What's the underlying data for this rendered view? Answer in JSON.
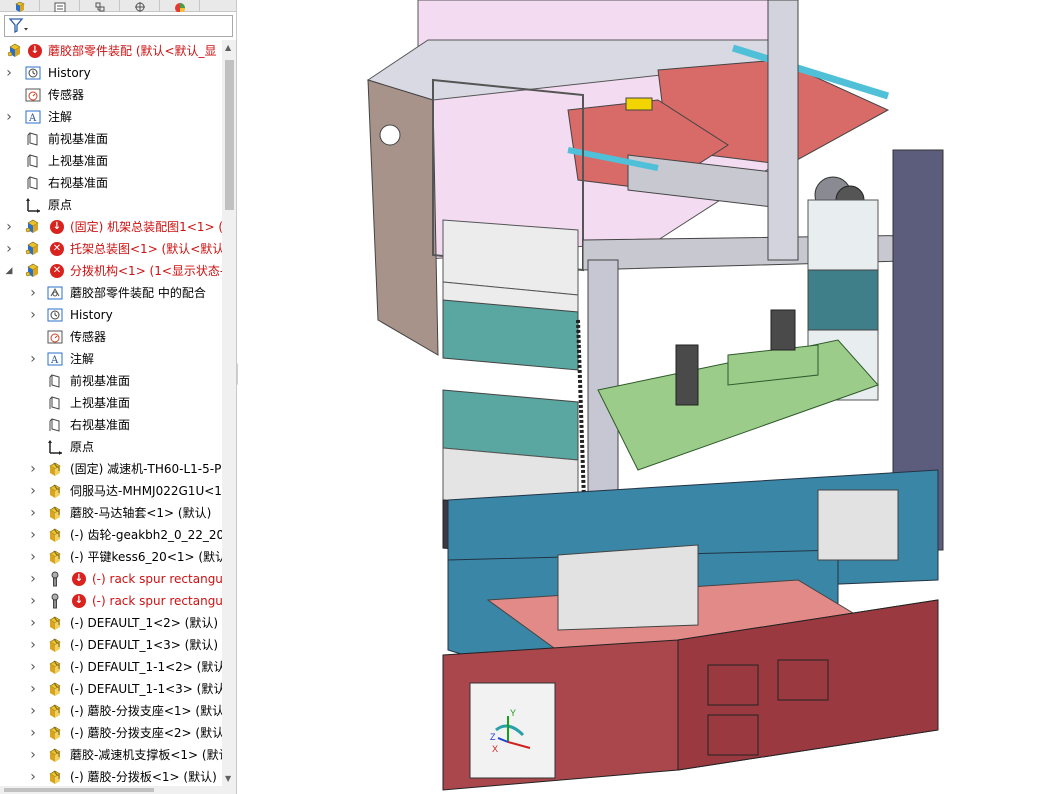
{
  "colors": {
    "error_red": "#cc1111",
    "warn_red": "#d8231f",
    "assembly_yellow": "#e8c22a",
    "assembly_blue": "#2a6fc9",
    "frame_gray": "#c8c8d0",
    "plate_teal": "#3a86a6",
    "base_red": "#a9474c",
    "green_part": "#9ccc8a"
  },
  "panel": {
    "tabs": [
      "feature-manager-icon",
      "property-manager-icon",
      "configuration-manager-icon",
      "dimxpert-icon",
      "display-manager-icon"
    ],
    "filter_icon": "filter-icon"
  },
  "tree": [
    {
      "level": 0,
      "expander": "",
      "icon": "assembly-icon",
      "status": "down",
      "label": "蘑胶部零件装配  (默认<默认_显",
      "error": true
    },
    {
      "level": 1,
      "expander": "right",
      "icon": "history-icon",
      "status": "",
      "label": "History",
      "error": false
    },
    {
      "level": 1,
      "expander": "",
      "icon": "sensor-icon",
      "status": "",
      "label": "传感器",
      "error": false
    },
    {
      "level": 1,
      "expander": "right",
      "icon": "annotation-icon",
      "status": "",
      "label": "注解",
      "error": false
    },
    {
      "level": 1,
      "expander": "",
      "icon": "plane-icon",
      "status": "",
      "label": "前视基准面",
      "error": false
    },
    {
      "level": 1,
      "expander": "",
      "icon": "plane-icon",
      "status": "",
      "label": "上视基准面",
      "error": false
    },
    {
      "level": 1,
      "expander": "",
      "icon": "plane-icon",
      "status": "",
      "label": "右视基准面",
      "error": false
    },
    {
      "level": 1,
      "expander": "",
      "icon": "origin-icon",
      "status": "",
      "label": "原点",
      "error": false
    },
    {
      "level": 1,
      "expander": "right",
      "icon": "assembly-icon",
      "status": "down",
      "label": "(固定) 机架总装配图1<1> (",
      "error": true
    },
    {
      "level": 1,
      "expander": "right",
      "icon": "assembly-icon",
      "status": "x",
      "label": "托架总装图<1> (默认<默认",
      "error": true
    },
    {
      "level": 1,
      "expander": "down",
      "icon": "assembly-icon",
      "status": "x",
      "label": "分拨机构<1> (1<显示状态-",
      "error": true
    },
    {
      "level": 2,
      "expander": "right",
      "icon": "mates-icon",
      "status": "",
      "label": "蘑胶部零件装配 中的配合",
      "error": false
    },
    {
      "level": 2,
      "expander": "right",
      "icon": "history-icon",
      "status": "",
      "label": "History",
      "error": false
    },
    {
      "level": 2,
      "expander": "",
      "icon": "sensor-icon",
      "status": "",
      "label": "传感器",
      "error": false
    },
    {
      "level": 2,
      "expander": "right",
      "icon": "annotation-icon",
      "status": "",
      "label": "注解",
      "error": false
    },
    {
      "level": 2,
      "expander": "",
      "icon": "plane-icon",
      "status": "",
      "label": "前视基准面",
      "error": false
    },
    {
      "level": 2,
      "expander": "",
      "icon": "plane-icon",
      "status": "",
      "label": "上视基准面",
      "error": false
    },
    {
      "level": 2,
      "expander": "",
      "icon": "plane-icon",
      "status": "",
      "label": "右视基准面",
      "error": false
    },
    {
      "level": 2,
      "expander": "",
      "icon": "origin-icon",
      "status": "",
      "label": "原点",
      "error": false
    },
    {
      "level": 2,
      "expander": "right",
      "icon": "part-icon",
      "status": "",
      "label": "(固定) 减速机-TH60-L1-5-P",
      "error": false
    },
    {
      "level": 2,
      "expander": "right",
      "icon": "part-icon",
      "status": "",
      "label": "伺服马达-MHMJ022G1U<1",
      "error": false
    },
    {
      "level": 2,
      "expander": "right",
      "icon": "part-icon",
      "status": "",
      "label": "蘑胶-马达轴套<1> (默认)",
      "error": false
    },
    {
      "level": 2,
      "expander": "right",
      "icon": "part-icon",
      "status": "",
      "label": "(-) 齿轮-geakbh2_0_22_20_",
      "error": false
    },
    {
      "level": 2,
      "expander": "right",
      "icon": "part-icon",
      "status": "",
      "label": "(-) 平键kess6_20<1> (默认",
      "error": false
    },
    {
      "level": 2,
      "expander": "right",
      "icon": "toolbox-icon",
      "status": "down",
      "label": "(-) rack spur rectangu",
      "error": true
    },
    {
      "level": 2,
      "expander": "right",
      "icon": "toolbox-icon",
      "status": "down",
      "label": "(-) rack spur rectangu",
      "error": true
    },
    {
      "level": 2,
      "expander": "right",
      "icon": "part-icon",
      "status": "",
      "label": "(-) DEFAULT_1<2> (默认)",
      "error": false
    },
    {
      "level": 2,
      "expander": "right",
      "icon": "part-icon",
      "status": "",
      "label": "(-) DEFAULT_1<3> (默认)",
      "error": false
    },
    {
      "level": 2,
      "expander": "right",
      "icon": "part-icon",
      "status": "",
      "label": "(-) DEFAULT_1-1<2> (默认",
      "error": false
    },
    {
      "level": 2,
      "expander": "right",
      "icon": "part-icon",
      "status": "",
      "label": "(-) DEFAULT_1-1<3> (默认",
      "error": false
    },
    {
      "level": 2,
      "expander": "right",
      "icon": "part-icon",
      "status": "",
      "label": "(-) 蘑胶-分拨支座<1> (默认",
      "error": false
    },
    {
      "level": 2,
      "expander": "right",
      "icon": "part-icon",
      "status": "",
      "label": "(-) 蘑胶-分拨支座<2> (默认",
      "error": false
    },
    {
      "level": 2,
      "expander": "right",
      "icon": "part-icon",
      "status": "",
      "label": "蘑胶-减速机支撑板<1> (默认",
      "error": false
    },
    {
      "level": 2,
      "expander": "right",
      "icon": "part-icon",
      "status": "",
      "label": "(-) 蘑胶-分拨板<1> (默认)",
      "error": false
    }
  ],
  "triad": {
    "x": "X",
    "y": "Y",
    "z": "Z"
  }
}
